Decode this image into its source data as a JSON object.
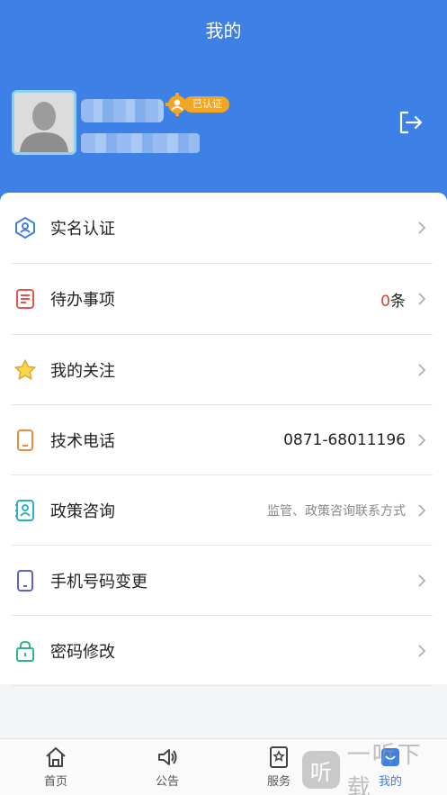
{
  "header": {
    "title": "我的",
    "verified_label": "已认证",
    "bg_color": "#3d80e6"
  },
  "menu": [
    {
      "label": "实名认证",
      "value": "",
      "icon": "id-verify-icon"
    },
    {
      "label": "待办事项",
      "count": "0",
      "unit": "条",
      "icon": "todo-list-icon"
    },
    {
      "label": "我的关注",
      "value": "",
      "icon": "star-icon"
    },
    {
      "label": "技术电话",
      "value": "0871-68011196",
      "icon": "phone-icon"
    },
    {
      "label": "政策咨询",
      "value": "监管、政策咨询联系方式",
      "icon": "contact-icon"
    },
    {
      "label": "手机号码变更",
      "value": "",
      "icon": "mobile-icon"
    },
    {
      "label": "密码修改",
      "value": "",
      "icon": "lock-icon"
    }
  ],
  "tabs": [
    {
      "label": "首页",
      "icon": "home-icon"
    },
    {
      "label": "公告",
      "icon": "speaker-icon"
    },
    {
      "label": "服务",
      "icon": "service-icon"
    },
    {
      "label": "我的",
      "icon": "profile-icon",
      "active": true
    }
  ],
  "watermark": {
    "text": "一听下载",
    "glyph": "听"
  }
}
